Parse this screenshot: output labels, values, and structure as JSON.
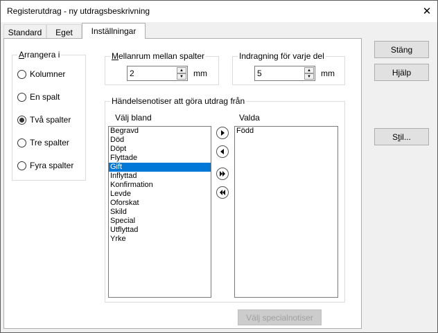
{
  "window": {
    "title": "Registerutdrag - ny utdragsbeskrivning",
    "close_glyph": "✕"
  },
  "tabs": [
    {
      "label": "Standard",
      "active": false
    },
    {
      "label": "Eget",
      "active": false
    },
    {
      "label": "Inställningar",
      "active": true
    }
  ],
  "arrange": {
    "title": "Arrangera i",
    "options": [
      {
        "label": "Kolumner",
        "checked": false
      },
      {
        "label": "En spalt",
        "checked": false
      },
      {
        "label": "Två spalter",
        "checked": true
      },
      {
        "label": "Tre spalter",
        "checked": false
      },
      {
        "label": "Fyra spalter",
        "checked": false
      }
    ]
  },
  "column_spacing": {
    "title": "Mellanrum mellan spalter",
    "value": "2",
    "unit": "mm"
  },
  "indent": {
    "title": "Indragning för varje del",
    "value": "5",
    "unit": "mm"
  },
  "events": {
    "title": "Händelsenotiser att göra utdrag från",
    "available_label": "Välj bland",
    "selected_label": "Valda",
    "available": [
      "Begravd",
      "Död",
      "Döpt",
      "Flyttade",
      "Gift",
      "Inflyttad",
      "Konfirmation",
      "Levde",
      "Oforskat",
      "Skild",
      "Special",
      "Utflyttad",
      "Yrke"
    ],
    "available_selected": "Gift",
    "selected": [
      "Född"
    ],
    "special_button": "Välj specialnotiser"
  },
  "buttons": {
    "close": "Stäng",
    "help_prefix": "H",
    "help_underline": "j",
    "help_suffix": "älp",
    "style_prefix": "S",
    "style_underline": "t",
    "style_suffix": "il..."
  },
  "colors": {
    "selection": "#0078d7",
    "panel": "#ffffff",
    "dialog": "#f0f0f0"
  }
}
